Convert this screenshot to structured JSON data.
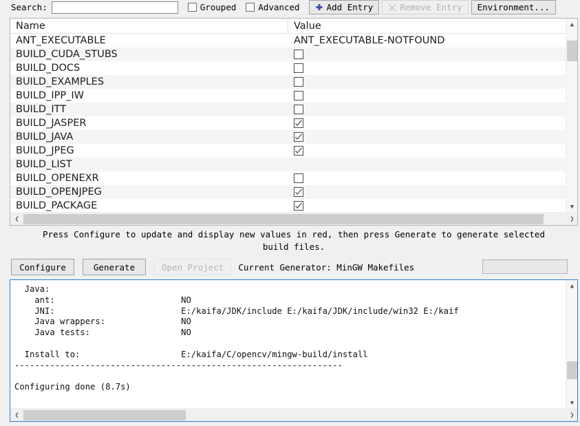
{
  "toolbar": {
    "search_label": "Search:",
    "search_value": "",
    "search_placeholder": "",
    "grouped_label": "Grouped",
    "grouped_checked": false,
    "advanced_label": "Advanced",
    "advanced_checked": false,
    "add_entry_label": "Add Entry",
    "add_entry_icon": "plus-icon",
    "add_entry_icon_color": "#3f51b5",
    "remove_entry_label": "Remove Entry",
    "remove_entry_icon": "cross-icon",
    "remove_entry_enabled": false,
    "environment_label": "Environment..."
  },
  "cache_table": {
    "columns": [
      "Name",
      "Value"
    ],
    "rows": [
      {
        "name": "ANT_EXECUTABLE",
        "value_type": "text",
        "value": "ANT_EXECUTABLE-NOTFOUND"
      },
      {
        "name": "BUILD_CUDA_STUBS",
        "value_type": "checkbox",
        "checked": false
      },
      {
        "name": "BUILD_DOCS",
        "value_type": "checkbox",
        "checked": false
      },
      {
        "name": "BUILD_EXAMPLES",
        "value_type": "checkbox",
        "checked": false
      },
      {
        "name": "BUILD_IPP_IW",
        "value_type": "checkbox",
        "checked": false
      },
      {
        "name": "BUILD_ITT",
        "value_type": "checkbox",
        "checked": false
      },
      {
        "name": "BUILD_JASPER",
        "value_type": "checkbox",
        "checked": true
      },
      {
        "name": "BUILD_JAVA",
        "value_type": "checkbox",
        "checked": true
      },
      {
        "name": "BUILD_JPEG",
        "value_type": "checkbox",
        "checked": true
      },
      {
        "name": "BUILD_LIST",
        "value_type": "text",
        "value": ""
      },
      {
        "name": "BUILD_OPENEXR",
        "value_type": "checkbox",
        "checked": false
      },
      {
        "name": "BUILD_OPENJPEG",
        "value_type": "checkbox",
        "checked": true
      },
      {
        "name": "BUILD_PACKAGE",
        "value_type": "checkbox",
        "checked": true
      }
    ],
    "vscroll_thumb_top_pct": 6,
    "vscroll_thumb_height_pct": 12,
    "hscroll_thumb_left_pct": 0,
    "hscroll_thumb_width_pct": 96
  },
  "hint": {
    "line1": "Press Configure to update and display new values in red, then press Generate to generate selected",
    "line2": "build files."
  },
  "actions": {
    "configure_label": "Configure",
    "generate_label": "Generate",
    "open_project_label": "Open Project",
    "open_project_enabled": false,
    "generator_text": "Current Generator: MinGW Makefiles",
    "progress_value": 0
  },
  "log": {
    "lines": [
      "  Java:",
      "    ant:                         NO",
      "    JNI:                         E:/kaifa/JDK/include E:/kaifa/JDK/include/win32 E:/kaif",
      "    Java wrappers:               NO",
      "    Java tests:                  NO",
      "",
      "  Install to:                    E:/kaifa/C/opencv/mingw-build/install",
      "-----------------------------------------------------------------",
      "",
      "Configuring done (8.7s)"
    ],
    "vscroll_thumb_top_pct": 66,
    "vscroll_thumb_height_pct": 17,
    "hscroll_thumb_left_pct": 0,
    "hscroll_thumb_width_pct": 30
  }
}
